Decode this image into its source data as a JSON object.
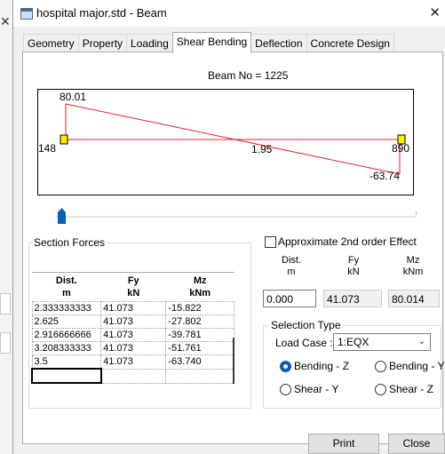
{
  "window": {
    "title": "hospital major.std - Beam"
  },
  "tabs": [
    {
      "label": "Geometry"
    },
    {
      "label": "Property"
    },
    {
      "label": "Loading"
    },
    {
      "label": "Shear Bending",
      "active": true
    },
    {
      "label": "Deflection"
    },
    {
      "label": "Concrete Design"
    }
  ],
  "beam_label": "Beam No = 1225",
  "diagram": {
    "left_value": "148",
    "right_value": "890",
    "max_value": "80.01",
    "mid_value": "1.95",
    "min_value": "-63.74",
    "line_color": "#e8202a",
    "support_color": "#ffee00"
  },
  "section_forces": {
    "title": "Section Forces",
    "headers": {
      "dist": "Dist.",
      "dist_unit": "m",
      "fy": "Fy",
      "fy_unit": "kN",
      "mz": "Mz",
      "mz_unit": "kNm"
    },
    "rows": [
      {
        "dist": "2.333333333",
        "fy": "41.073",
        "mz": "-15.822"
      },
      {
        "dist": "2.625",
        "fy": "41.073",
        "mz": "-27.802"
      },
      {
        "dist": "2.916666666",
        "fy": "41.073",
        "mz": "-39.781"
      },
      {
        "dist": "3.208333333",
        "fy": "41.073",
        "mz": "-51.761"
      },
      {
        "dist": "3.5",
        "fy": "41.073",
        "mz": "-63.740"
      },
      {
        "dist": "",
        "fy": "",
        "mz": ""
      }
    ]
  },
  "approx": {
    "label": "Approximate 2nd order Effect",
    "checked": false,
    "headers": {
      "dist": "Dist.",
      "dist_unit": "m",
      "fy": "Fy",
      "fy_unit": "kN",
      "mz": "Mz",
      "mz_unit": "kNm"
    },
    "values": {
      "dist": "0.000",
      "fy": "41.073",
      "mz": "80.014"
    }
  },
  "selection_type": {
    "title": "Selection Type",
    "load_case_label": "Load Case :",
    "load_case_value": "1:EQX",
    "options": {
      "bending_z": "Bending - Z",
      "bending_y": "Bending - Y",
      "shear_y": "Shear - Y",
      "shear_z": "Shear - Z"
    },
    "selected": "Bending - Z"
  },
  "buttons": {
    "print": "Print",
    "close": "Close"
  }
}
